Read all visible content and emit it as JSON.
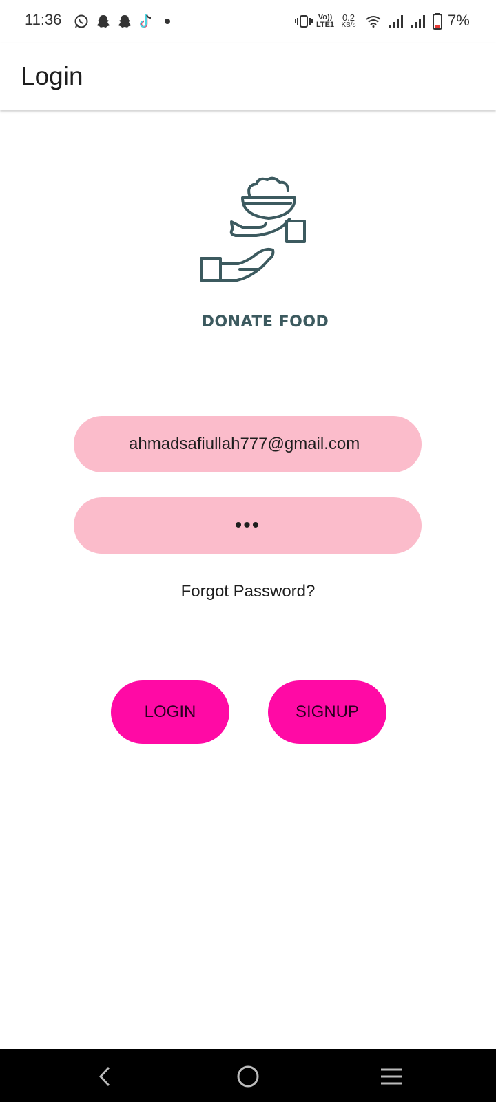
{
  "status_bar": {
    "time": "11:36",
    "notification_icons": [
      "whatsapp-icon",
      "snapchat-icon",
      "snapchat-icon",
      "tiktok-icon",
      "dot-icon"
    ],
    "network_label_top": "Vo))",
    "network_label_bottom": "LTE1",
    "data_speed_value": "0.2",
    "data_speed_unit": "KB/s",
    "battery_percent": "7%"
  },
  "app_bar": {
    "title": "Login"
  },
  "logo": {
    "text": "DONATE FOOD",
    "color": "#3c5a5f"
  },
  "form": {
    "email_value": "ahmadsafiullah777@gmail.com",
    "password_value": "•••",
    "forgot_password_label": "Forgot Password?"
  },
  "buttons": {
    "login_label": "LOGIN",
    "signup_label": "SIGNUP"
  },
  "colors": {
    "field_bg": "#fbbccb",
    "button_bg": "#ff0aa5",
    "nav_bg": "#000000"
  },
  "nav_bar": {
    "icons": [
      "back-icon",
      "home-icon",
      "recents-icon"
    ]
  }
}
